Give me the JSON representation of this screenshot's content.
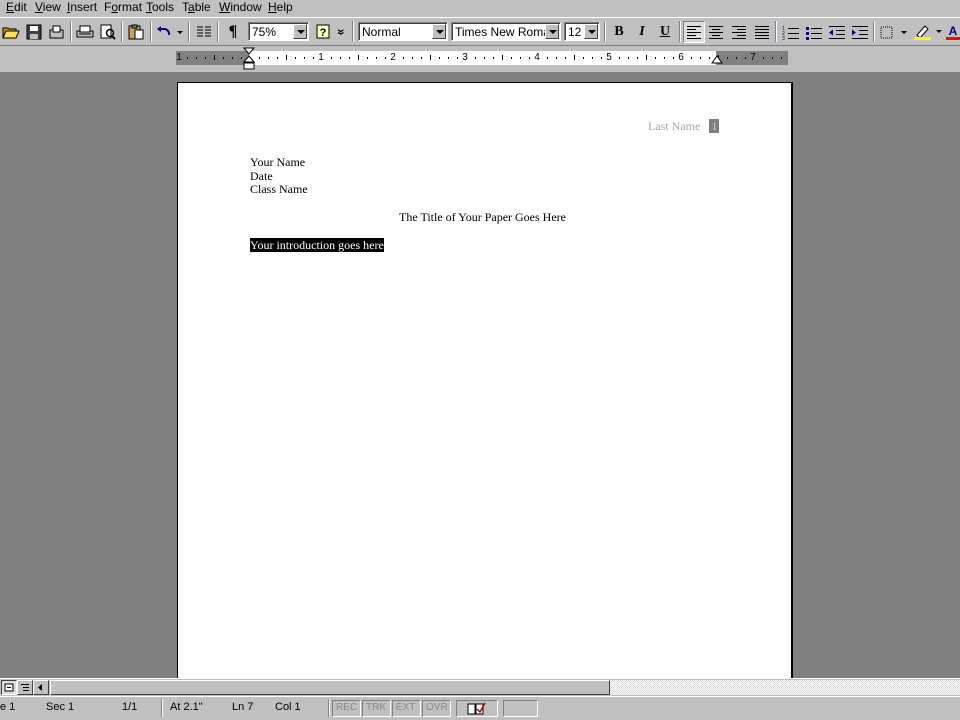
{
  "menu": [
    "Edit",
    "View",
    "Insert",
    "Format",
    "Tools",
    "Table",
    "Window",
    "Help"
  ],
  "menu_underline": [
    "E",
    "V",
    "I",
    "o",
    "T",
    "a",
    "W",
    "H"
  ],
  "toolbar": {
    "zoom": "75%",
    "style": "Normal",
    "font": "Times New Roman",
    "size": "12",
    "bold": "B",
    "italic": "I",
    "underline": "U",
    "paragraph_mark": "¶",
    "more": "»",
    "help": "?"
  },
  "ruler": {
    "numbers": [
      "1",
      "1",
      "2",
      "3",
      "4",
      "5",
      "6",
      "7"
    ]
  },
  "document": {
    "header_name": "Last Name",
    "page_number": "1",
    "lines": [
      "Your Name",
      "Date",
      "Class Name"
    ],
    "title": "The Title of Your Paper Goes Here",
    "intro": "Your introduction goes here"
  },
  "statusbar": {
    "page": "e 1",
    "section": "Sec  1",
    "pages": "1/1",
    "at": "At  2.1\"",
    "line": "Ln  7",
    "col": "Col  1",
    "rec": "REC",
    "trk": "TRK",
    "ext": "EXT",
    "ovr": "OVR"
  },
  "colors": {
    "chrome": "#c0c0c0",
    "workspace": "#808080",
    "page": "#ffffff",
    "highlight": "#000000"
  }
}
